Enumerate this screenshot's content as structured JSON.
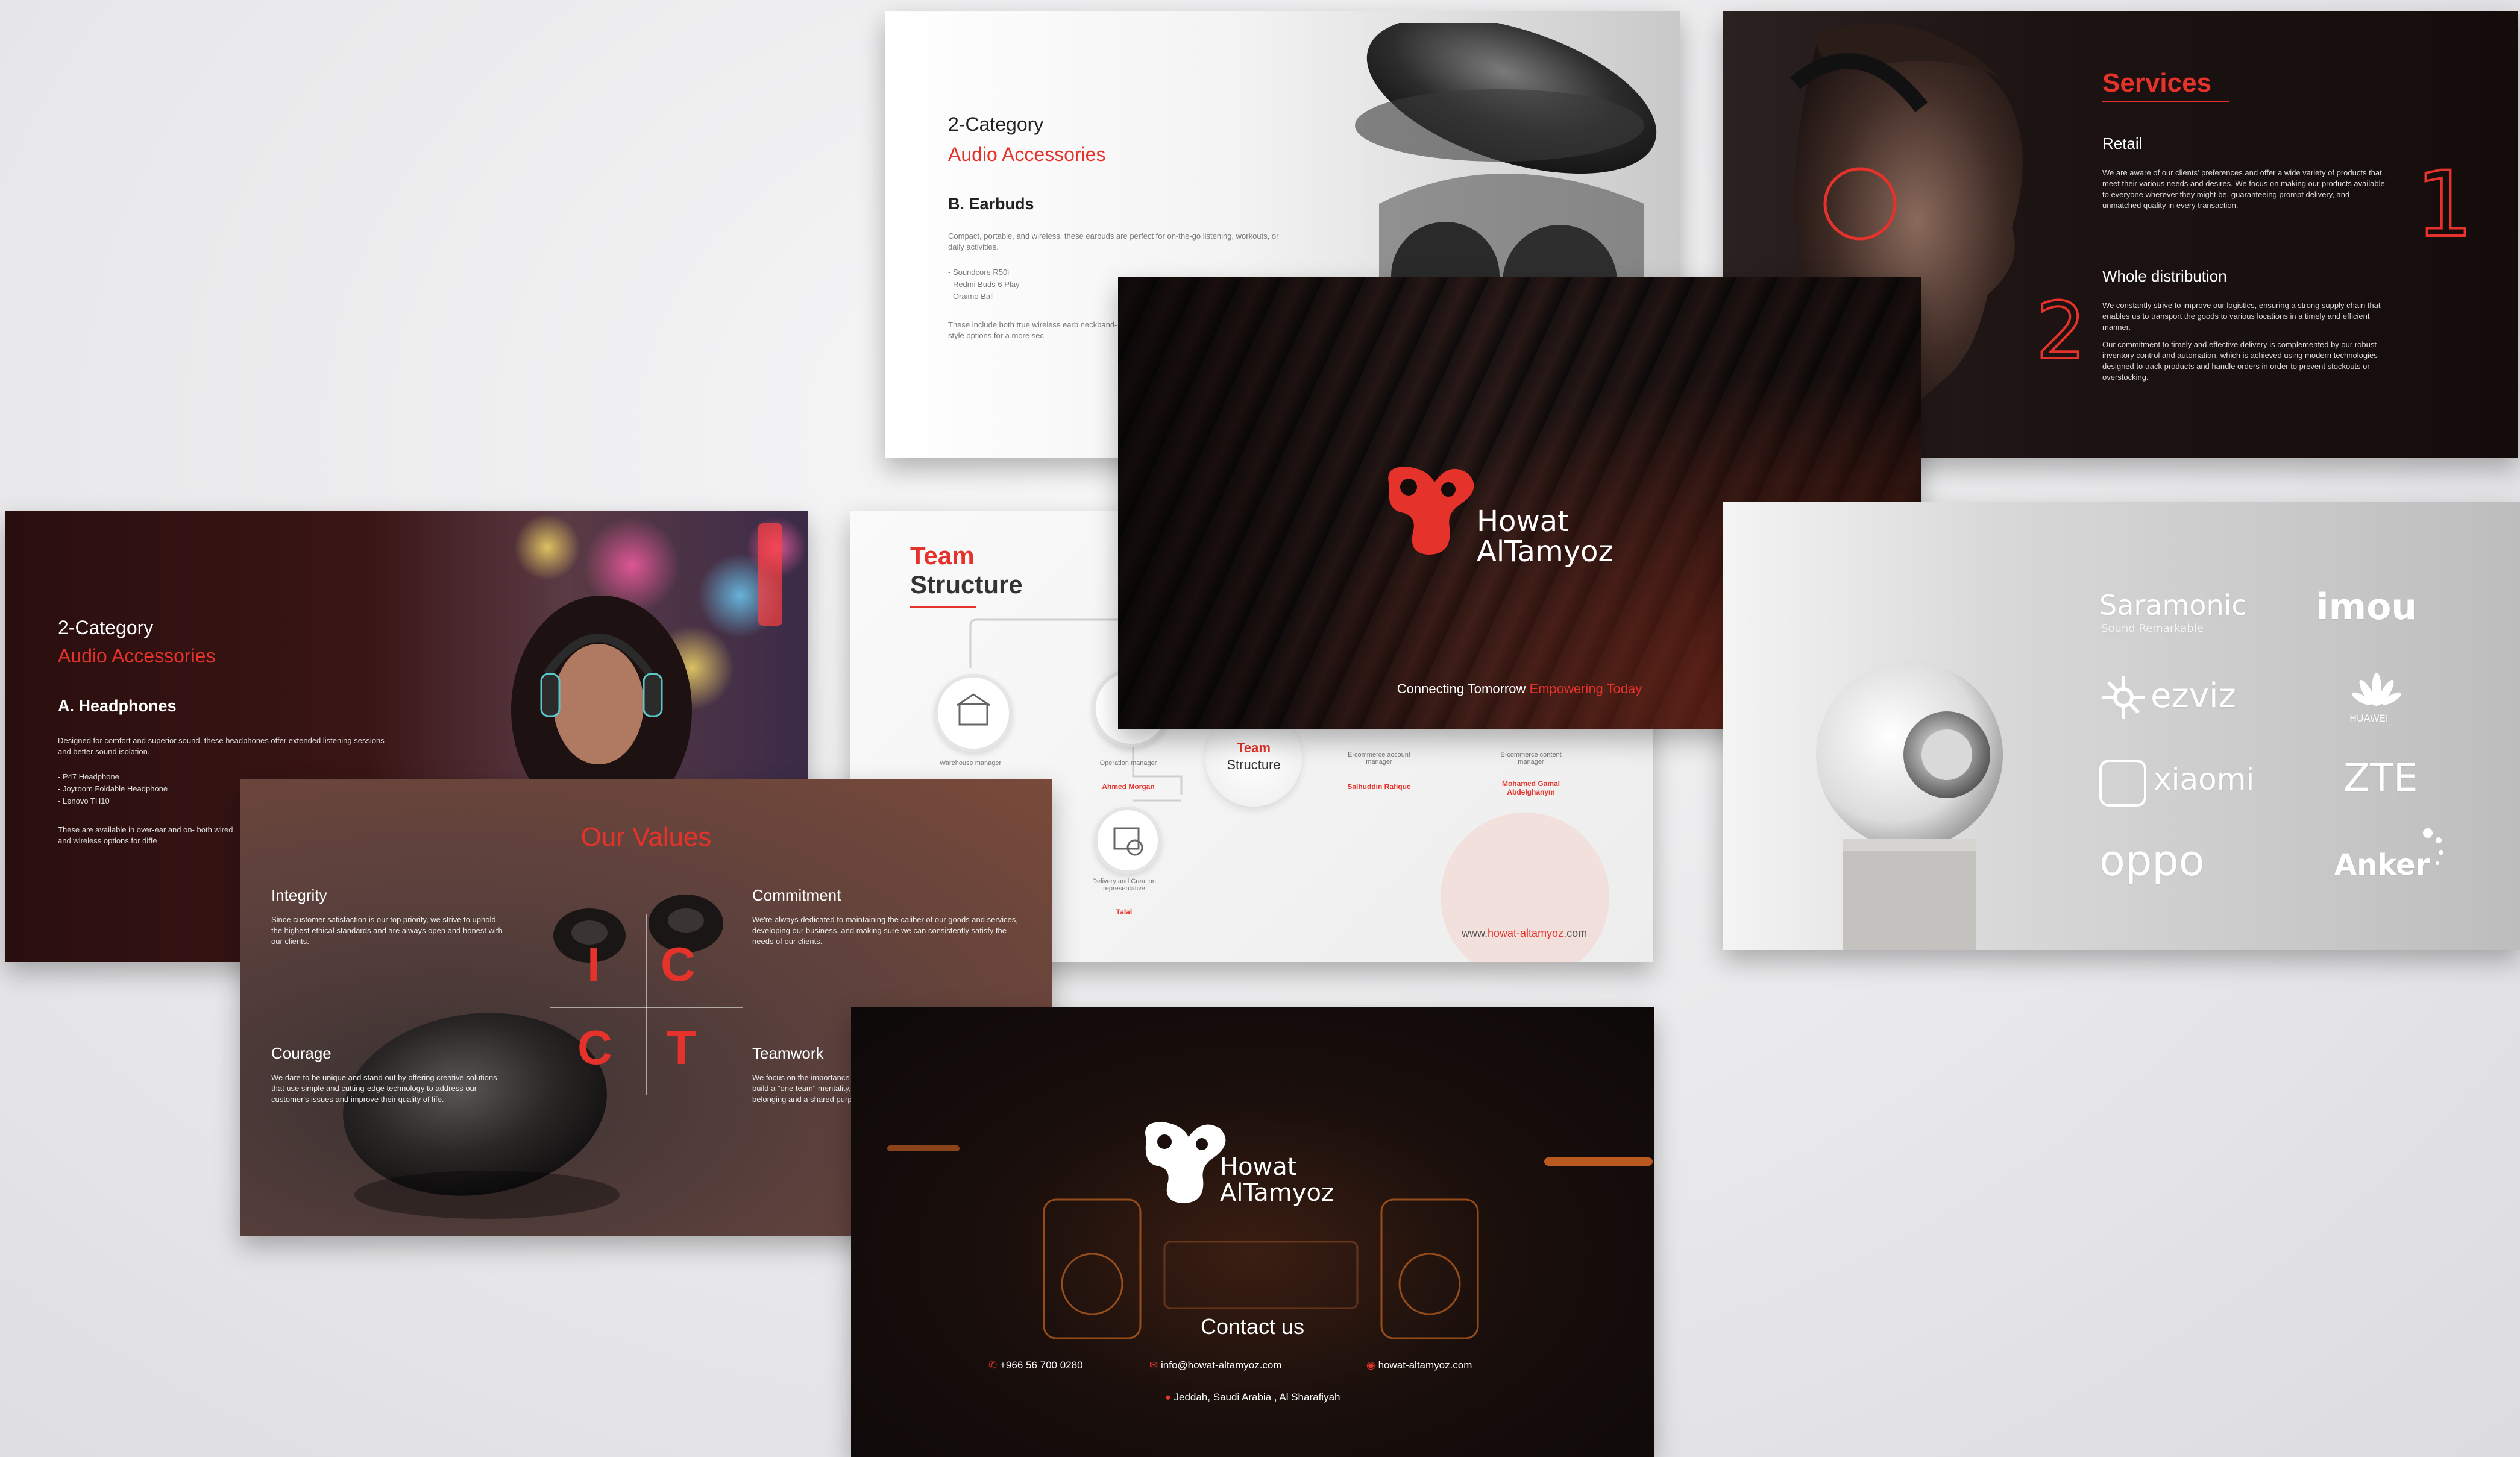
{
  "earbuds": {
    "category": "2-Category",
    "subtitle": "Audio Accessories",
    "heading": "B. Earbuds",
    "desc": "Compact, portable, and wireless, these earbuds are perfect for on-the-go listening, workouts, or daily activities.",
    "items": [
      "- Soundcore R50i",
      "- Redmi Buds 6 Play",
      "- Oraimo Ball"
    ],
    "note": "These include both true wireless earb neckband-style options for a more sec"
  },
  "services": {
    "title": "Services",
    "retail_title": "Retail",
    "retail_text": "We are aware of our clients' preferences and offer a wide variety of products that meet their various needs and desires. We focus on making our products available to everyone wherever they might be, guaranteeing prompt delivery, and unmatched quality in every transaction.",
    "num1": "1",
    "whole_title": "Whole distribution",
    "whole_text1": "We constantly strive to improve our logistics, ensuring a strong supply chain that enables us to transport the goods to various locations in a timely and efficient manner.",
    "whole_text2": "Our commitment to timely and effective delivery is complemented by our robust inventory control and automation, which is achieved using modern technologies designed to track products and handle orders in order to prevent stockouts or overstocking.",
    "num2": "2"
  },
  "logo_slide": {
    "brand_line1": "Howat",
    "brand_line2": "AlTamyoz",
    "tagline_a": "Connecting Tomorrow",
    "tagline_b": "Empowering Today"
  },
  "headphones": {
    "category": "2-Category",
    "subtitle": "Audio Accessories",
    "heading": "A. Headphones",
    "desc": "Designed for comfort and superior sound, these headphones offer extended listening sessions and better sound isolation.",
    "items": [
      "- P47 Headphone",
      "- Joyroom Foldable Headphone",
      "- Lenovo TH10"
    ],
    "note": "These are available in over-ear and on- both wired and wireless options for diffe"
  },
  "team": {
    "title_a": "Team",
    "title_b": "Structure",
    "center_a": "Team",
    "center_b": "Structure",
    "nodes": [
      {
        "role": "Warehouse manager",
        "name": ""
      },
      {
        "role": "Operation manager",
        "name": "Ahmed Morgan"
      },
      {
        "role": "E-commerce account manager",
        "name": "Salhuddin Rafique"
      },
      {
        "role": "E-commerce content manager",
        "name": "Mohamed Gamal Abdelghanym"
      },
      {
        "role": "Delivery and Creation representative",
        "name": "Talal"
      }
    ],
    "website_a": "www.",
    "website_b": "howat-altamyoz",
    "website_c": ".com"
  },
  "brands": {
    "saramonic": "Saramonic",
    "saramonic_sub": "Sound Remarkable",
    "imou": "imou",
    "ezviz": "ezviz",
    "huawei": "HUAWEI",
    "xiaomi": "xiaomi",
    "zte": "ZTE",
    "oppo": "oppo",
    "anker": "Anker"
  },
  "values": {
    "title": "Our Values",
    "integrity_title": "Integrity",
    "integrity_text": "Since customer satisfaction is our top priority, we strive to uphold the highest ethical standards and are always open and honest with our clients.",
    "commitment_title": "Commitment",
    "commitment_text": "We're always dedicated to maintaining the caliber of our goods and services, developing our business, and making sure we can consistently satisfy the needs of our clients.",
    "courage_title": "Courage",
    "courage_text": "We dare to be unique and stand out by offering creative solutions that use simple and cutting-edge technology to address our customer's issues and improve their quality of life.",
    "teamwork_title": "Teamwork",
    "teamwork_text": "We focus on the importance of collaboration through investing in programs that build a \"one team\" mentality, helping all our customers to feel a sense of belonging and a shared purpose.",
    "letters": [
      "I",
      "C",
      "C",
      "T"
    ]
  },
  "contact": {
    "brand_line1": "Howat",
    "brand_line2": "AlTamyoz",
    "title": "Contact us",
    "phone": "+966 56 700 0280",
    "email": "info@howat-altamyoz.com",
    "web": "howat-altamyoz.com",
    "address": "Jeddah, Saudi Arabia , Al Sharafiyah"
  },
  "colors": {
    "accent": "#e5322b",
    "dark": "#140c0b"
  }
}
